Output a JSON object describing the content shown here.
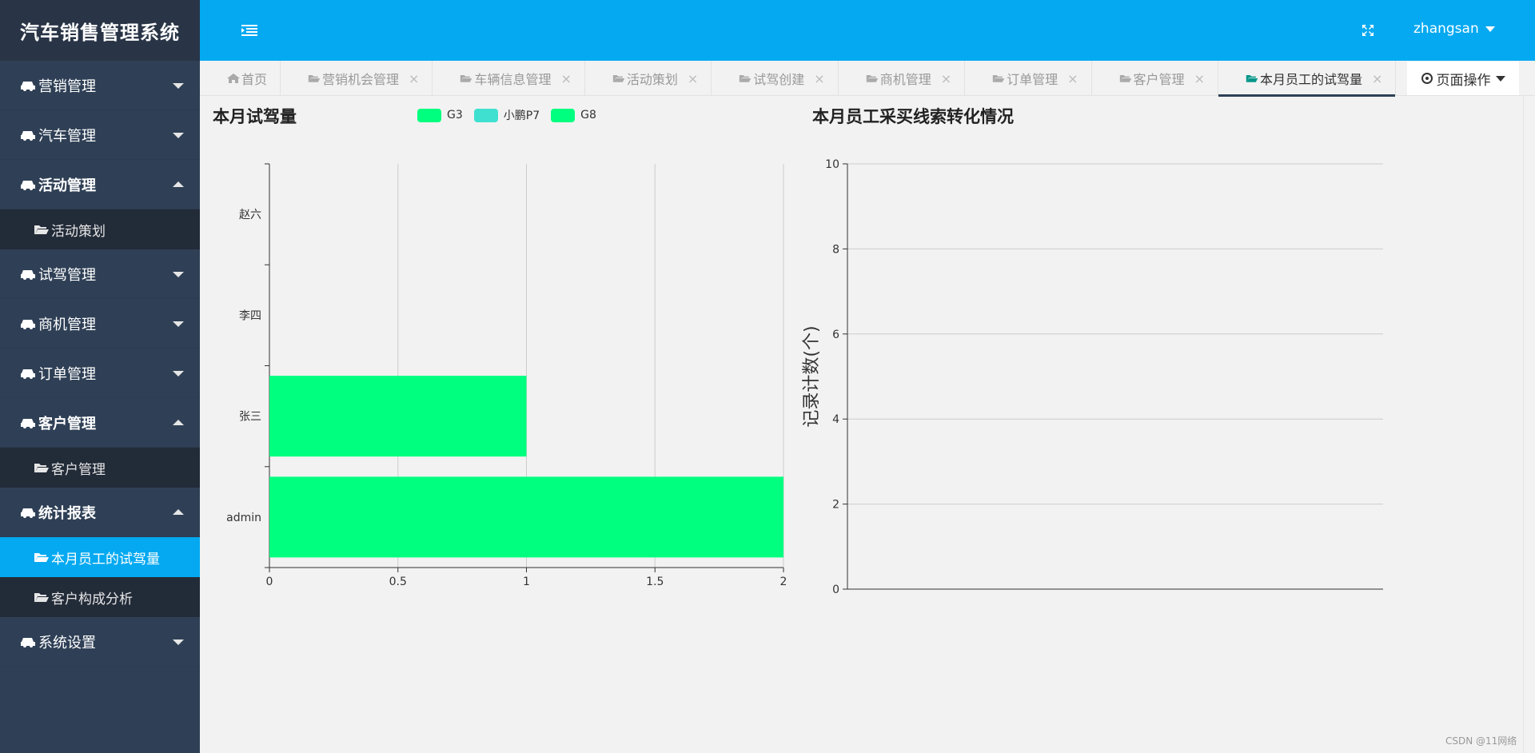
{
  "app": {
    "title": "汽车销售管理系统",
    "user": "zhangsan"
  },
  "sidebar": {
    "items": [
      {
        "label": "营销管理"
      },
      {
        "label": "汽车管理"
      },
      {
        "label": "活动管理",
        "sub": [
          "活动策划"
        ]
      },
      {
        "label": "试驾管理"
      },
      {
        "label": "商机管理"
      },
      {
        "label": "订单管理"
      },
      {
        "label": "客户管理",
        "sub": [
          "客户管理"
        ]
      },
      {
        "label": "统计报表",
        "sub": [
          "本月员工的试驾量",
          "客户构成分析"
        ]
      },
      {
        "label": "系统设置"
      }
    ]
  },
  "tabs": {
    "home": "首页",
    "items": [
      "营销机会管理",
      "车辆信息管理",
      "活动策划",
      "试驾创建",
      "商机管理",
      "订单管理",
      "客户管理",
      "本月员工的试驾量"
    ],
    "page_ops": "页面操作"
  },
  "chart_data": [
    {
      "type": "bar",
      "orientation": "horizontal",
      "title": "本月试驾量",
      "categories": [
        "admin",
        "张三",
        "李四",
        "赵六"
      ],
      "series": [
        {
          "name": "G3",
          "color": "#00ff7f",
          "values": [
            2,
            1,
            0,
            0
          ]
        },
        {
          "name": "小鹏P7",
          "color": "#40e0d0",
          "values": [
            0,
            0,
            0,
            0
          ]
        },
        {
          "name": "G8",
          "color": "#00ff7f",
          "values": [
            0,
            0,
            0,
            0
          ]
        }
      ],
      "x_ticks": [
        "0",
        "0.5",
        "1",
        "1.5",
        "2"
      ],
      "xlim": [
        0,
        2
      ],
      "legend_position": "top"
    },
    {
      "type": "bar",
      "title": "本月员工采买线索转化情况",
      "ylabel": "记录计数(个)",
      "y_ticks": [
        "0",
        "2",
        "4",
        "6",
        "8",
        "10"
      ],
      "ylim": [
        0,
        10
      ],
      "categories": [],
      "series": []
    }
  ],
  "watermark": "CSDN @11网络"
}
